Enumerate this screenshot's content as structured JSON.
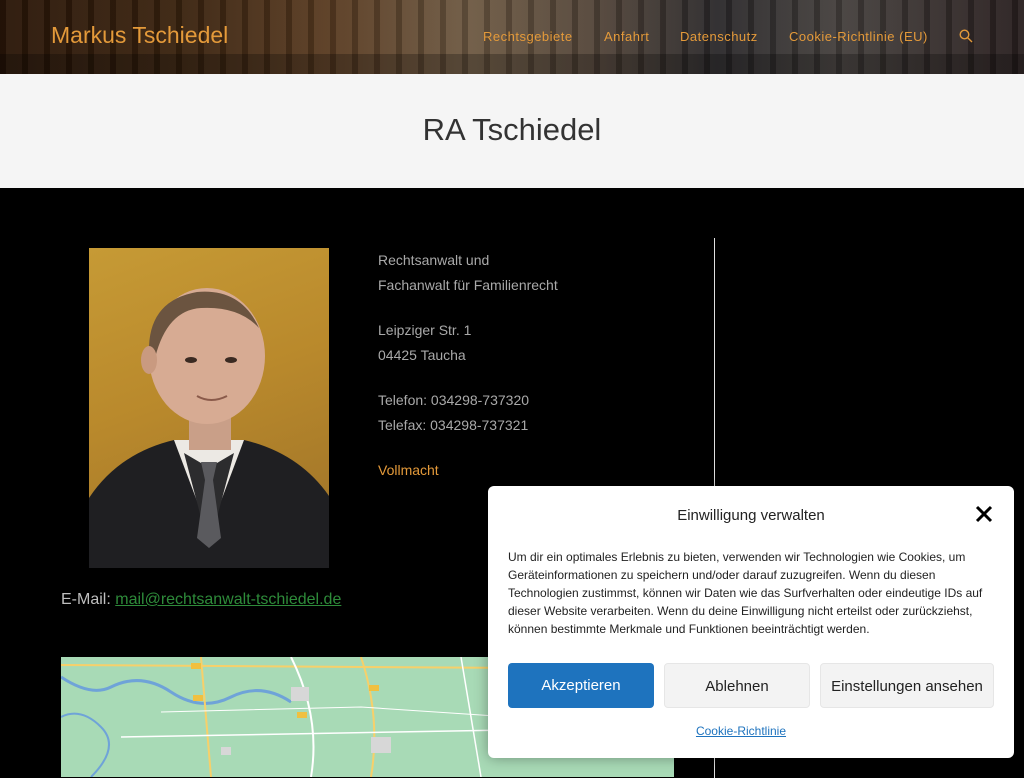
{
  "header": {
    "site_title": "Markus Tschiedel",
    "nav": [
      "Rechtsgebiete",
      "Anfahrt",
      "Datenschutz",
      "Cookie-Richtlinie (EU)"
    ],
    "search_icon": "search-icon"
  },
  "page": {
    "title": "RA Tschiedel"
  },
  "profile": {
    "line1": "Rechtsanwalt und",
    "line2": "Fachanwalt für Familienrecht",
    "street": "Leipziger Str. 1",
    "city": "04425 Taucha",
    "phone": "Telefon: 034298-737320",
    "fax": "Telefax: 034298-737321",
    "vollmacht": "Vollmacht",
    "email_label": "E-Mail: ",
    "email": "mail@rechtsanwalt-tschiedel.de"
  },
  "consent": {
    "title": "Einwilligung verwalten",
    "text": "Um dir ein optimales Erlebnis zu bieten, verwenden wir Technologien wie Cookies, um Geräteinformationen zu speichern und/oder darauf zuzugreifen. Wenn du diesen Technologien zustimmst, können wir Daten wie das Surfverhalten oder eindeutige IDs auf dieser Website verarbeiten. Wenn du deine Einwilligung nicht erteilst oder zurückziehst, können bestimmte Merkmale und Funktionen beeinträchtigt werden.",
    "accept": "Akzeptieren",
    "deny": "Ablehnen",
    "settings": "Einstellungen ansehen",
    "policy_link": "Cookie-Richtlinie"
  },
  "colors": {
    "accent": "#e49a3a",
    "link_green": "#2e8b3a",
    "primary_button": "#1e73be"
  }
}
